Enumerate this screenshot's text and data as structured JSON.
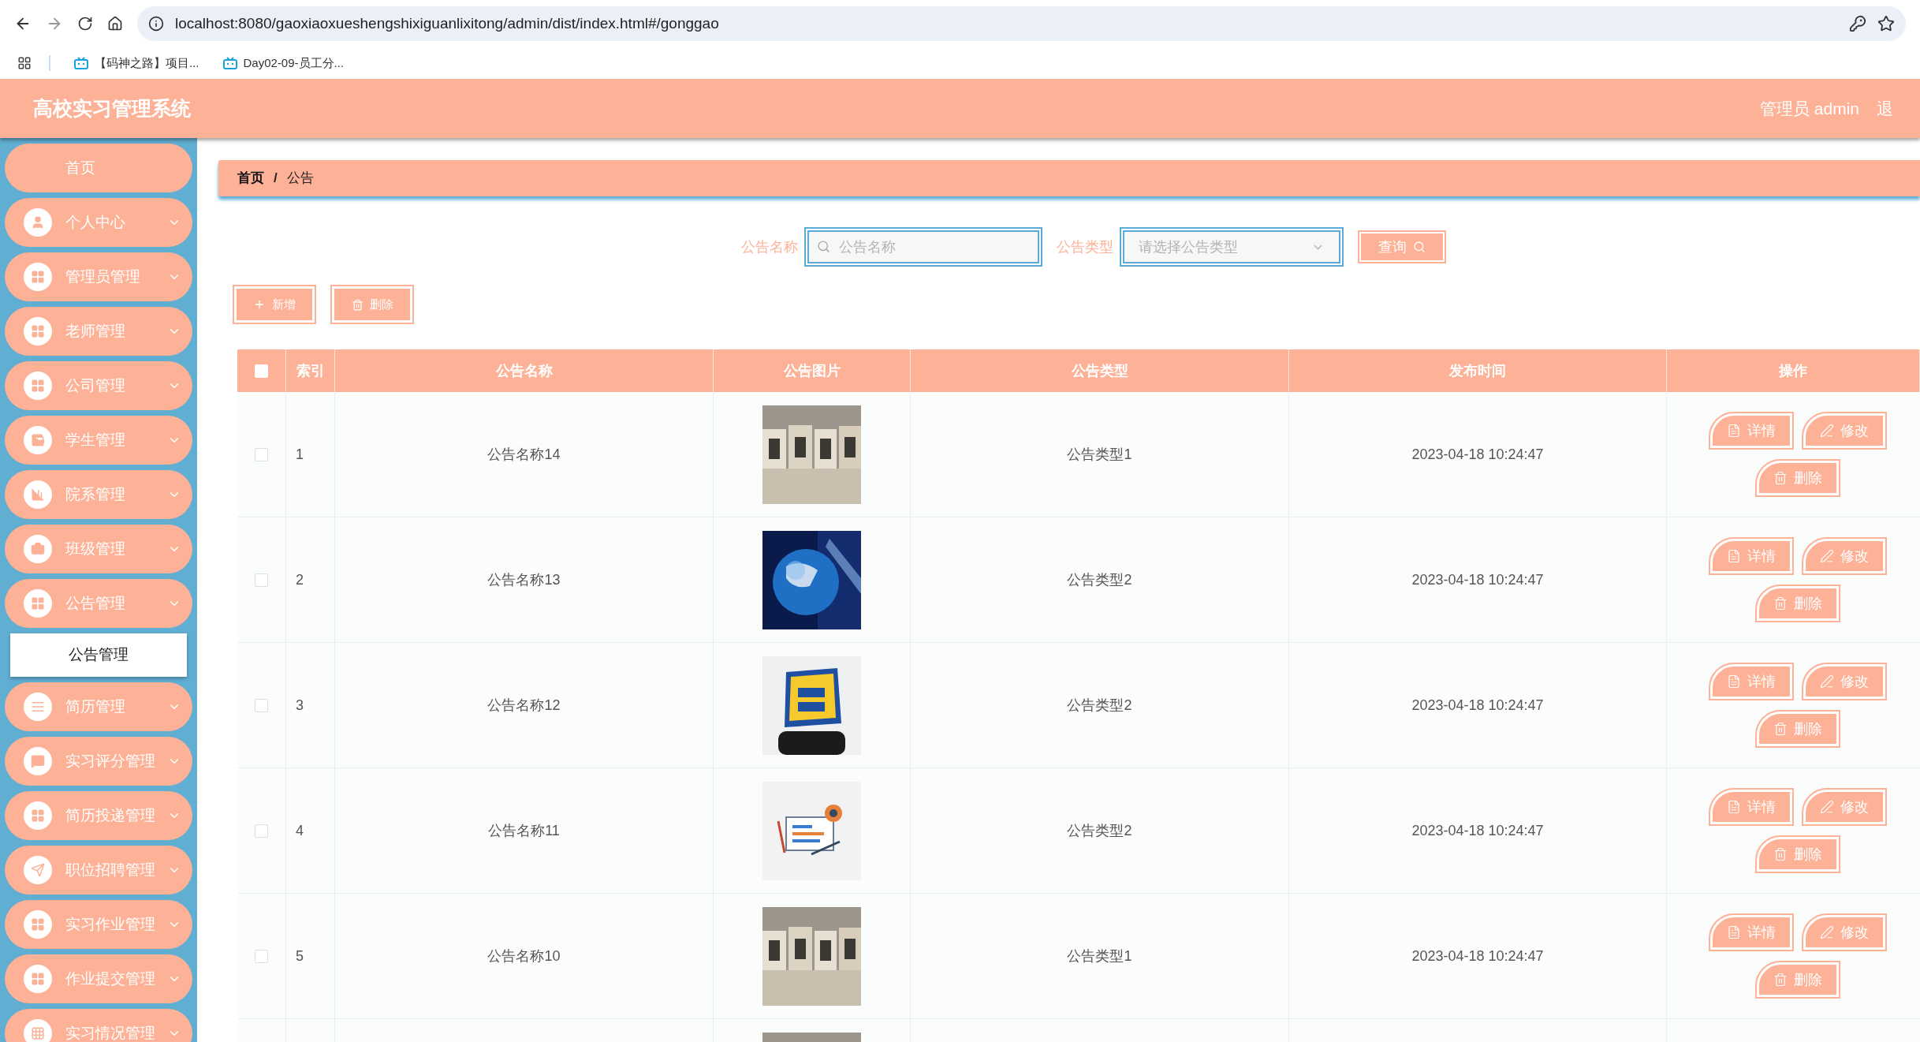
{
  "browser": {
    "url": "localhost:8080/gaoxiaoxueshengshixiguanlixitong/admin/dist/index.html#/gonggao",
    "bookmarks": [
      "【码神之路】项目...",
      "Day02-09-员工分..."
    ]
  },
  "header": {
    "title": "高校实习管理系统",
    "user": "管理员 admin",
    "logout": "退"
  },
  "sidebar": {
    "items": [
      {
        "label": "首页"
      },
      {
        "label": "个人中心"
      },
      {
        "label": "管理员管理"
      },
      {
        "label": "老师管理"
      },
      {
        "label": "公司管理"
      },
      {
        "label": "学生管理"
      },
      {
        "label": "院系管理"
      },
      {
        "label": "班级管理"
      },
      {
        "label": "公告管理",
        "children": [
          {
            "label": "公告管理",
            "selected": true
          }
        ]
      },
      {
        "label": "简历管理"
      },
      {
        "label": "实习评分管理"
      },
      {
        "label": "简历投递管理"
      },
      {
        "label": "职位招聘管理"
      },
      {
        "label": "实习作业管理"
      },
      {
        "label": "作业提交管理"
      },
      {
        "label": "实习情况管理"
      }
    ]
  },
  "breadcrumb": {
    "items": [
      "首页",
      "公告"
    ],
    "separator": "/"
  },
  "search": {
    "name_label": "公告名称",
    "name_placeholder": "公告名称",
    "type_label": "公告类型",
    "type_placeholder": "请选择公告类型",
    "button": "查询"
  },
  "actions": [
    "新增",
    "删除"
  ],
  "table": {
    "select_all_checked": false,
    "columns": [
      "索引",
      "公告名称",
      "公告图片",
      "公告类型",
      "发布时间",
      "操作"
    ],
    "rows": [
      {
        "checked": false,
        "index": "1",
        "name": "公告名称14",
        "image": {
          "kind": "picture"
        },
        "type": "公告类型1",
        "time": "2023-04-18 10:24:47",
        "actions": [
          "详情",
          "修改",
          "删除"
        ]
      },
      {
        "checked": false,
        "index": "2",
        "name": "公告名称13",
        "image": {
          "kind": "picture"
        },
        "type": "公告类型2",
        "time": "2023-04-18 10:24:47",
        "actions": [
          "详情",
          "修改",
          "删除"
        ]
      },
      {
        "checked": false,
        "index": "3",
        "name": "公告名称12",
        "image": {
          "kind": "picture"
        },
        "type": "公告类型2",
        "time": "2023-04-18 10:24:47",
        "actions": [
          "详情",
          "修改",
          "删除"
        ]
      },
      {
        "checked": false,
        "index": "4",
        "name": "公告名称11",
        "image": {
          "kind": "picture"
        },
        "type": "公告类型2",
        "time": "2023-04-18 10:24:47",
        "actions": [
          "详情",
          "修改",
          "删除"
        ]
      },
      {
        "checked": false,
        "index": "5",
        "name": "公告名称10",
        "image": {
          "kind": "picture"
        },
        "type": "公告类型1",
        "time": "2023-04-18 10:24:47",
        "actions": [
          "详情",
          "修改",
          "删除"
        ]
      },
      {
        "image": {
          "kind": "picture"
        }
      }
    ]
  }
}
